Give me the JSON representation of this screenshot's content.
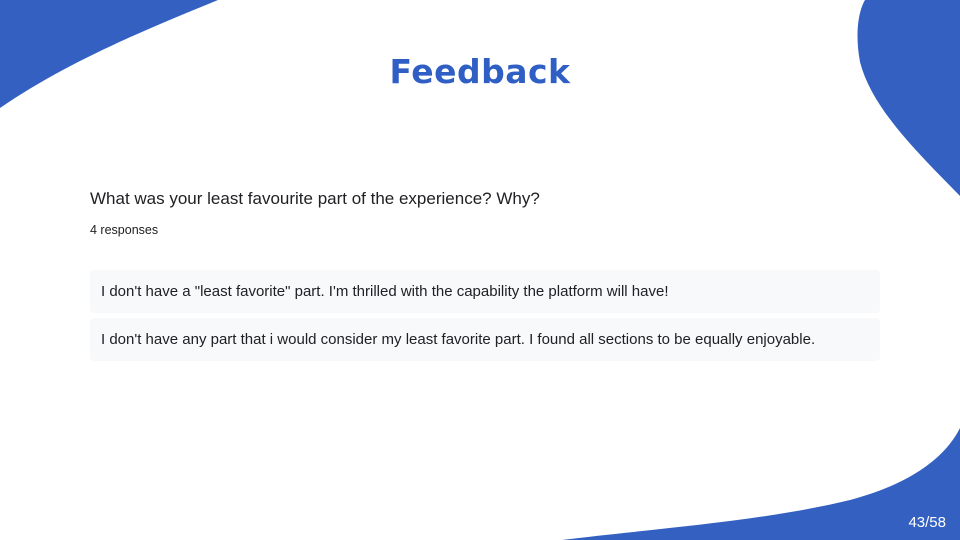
{
  "slide": {
    "title": "Feedback",
    "page_number": "43/58",
    "accent_color": "#2f5fc4"
  },
  "question": {
    "text": "What was your least favourite part of the experience? Why?",
    "response_count": "4 responses"
  },
  "answers": [
    "I don't have a \"least favorite\" part. I'm thrilled with the capability the platform will have!",
    "I don't have any part that i would consider my least favorite part. I found all sections to be equally enjoyable."
  ]
}
